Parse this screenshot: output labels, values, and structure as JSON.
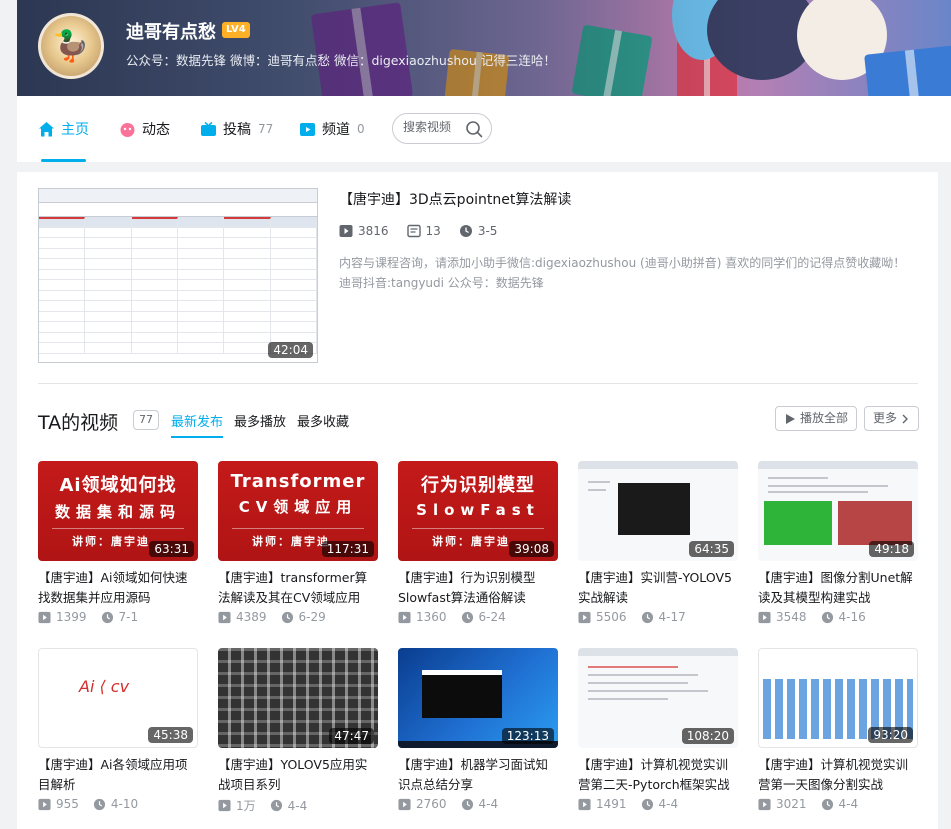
{
  "user": {
    "name": "迪哥有点愁",
    "level": "LV4",
    "sign": "公众号：数据先锋 微博：迪哥有点愁 微信：digexiaozhushou 记得三连哈！"
  },
  "nav": {
    "tabs": [
      {
        "label": "主页",
        "count": ""
      },
      {
        "label": "动态",
        "count": ""
      },
      {
        "label": "投稿",
        "count": "77"
      },
      {
        "label": "频道",
        "count": "0"
      }
    ],
    "search_placeholder": "搜索视频"
  },
  "featured": {
    "title": "【唐宇迪】3D点云pointnet算法解读",
    "duration": "42:04",
    "plays": "3816",
    "comments": "13",
    "date": "3-5",
    "description": "内容与课程咨询，请添加小助手微信:digexiaozhushou (迪哥小助拼音) 喜欢的同学们的记得点赞收藏呦！迪哥抖音:tangyudi 公众号：数据先锋"
  },
  "videos_section": {
    "title": "TA的视频",
    "count": "77",
    "sorts": [
      "最新发布",
      "最多播放",
      "最多收藏"
    ],
    "play_all": "播放全部",
    "more": "更多"
  },
  "videos": [
    {
      "title": "【唐宇迪】Ai领域如何快速找数据集并应用源码",
      "duration": "63:31",
      "plays": "1399",
      "date": "7-1",
      "cover": {
        "t1": "Ai领域如何找",
        "t2": "数据集和源码",
        "t3": "讲师：唐宇迪"
      }
    },
    {
      "title": "【唐宇迪】transformer算法解读及其在CV领域应用",
      "duration": "117:31",
      "plays": "4389",
      "date": "6-29",
      "cover": {
        "t1": "Transformer",
        "t2": "CV领域应用",
        "t3": "讲师：唐宇迪"
      }
    },
    {
      "title": "【唐宇迪】行为识别模型Slowfast算法通俗解读",
      "duration": "39:08",
      "plays": "1360",
      "date": "6-24",
      "cover": {
        "t1": "行为识别模型",
        "t2": "SlowFast",
        "t3": "讲师：唐宇迪"
      }
    },
    {
      "title": "【唐宇迪】实训营-YOLOV5实战解读",
      "duration": "64:35",
      "plays": "5506",
      "date": "4-17"
    },
    {
      "title": "【唐宇迪】图像分割Unet解读及其模型构建实战",
      "duration": "49:18",
      "plays": "3548",
      "date": "4-16"
    },
    {
      "title": "【唐宇迪】Ai各领域应用项目解析",
      "duration": "45:38",
      "plays": "955",
      "date": "4-10"
    },
    {
      "title": "【唐宇迪】YOLOV5应用实战项目系列",
      "duration": "47:47",
      "plays": "1万",
      "date": "4-4"
    },
    {
      "title": "【唐宇迪】机器学习面试知识点总结分享",
      "duration": "123:13",
      "plays": "2760",
      "date": "4-4"
    },
    {
      "title": "【唐宇迪】计算机视觉实训营第二天-Pytorch框架实战",
      "duration": "108:20",
      "plays": "1491",
      "date": "4-4"
    },
    {
      "title": "【唐宇迪】计算机视觉实训营第一天图像分割实战",
      "duration": "93:20",
      "plays": "3021",
      "date": "4-4"
    }
  ],
  "colors": {
    "accent": "#00aeec",
    "level_badge": "#ffb027"
  }
}
